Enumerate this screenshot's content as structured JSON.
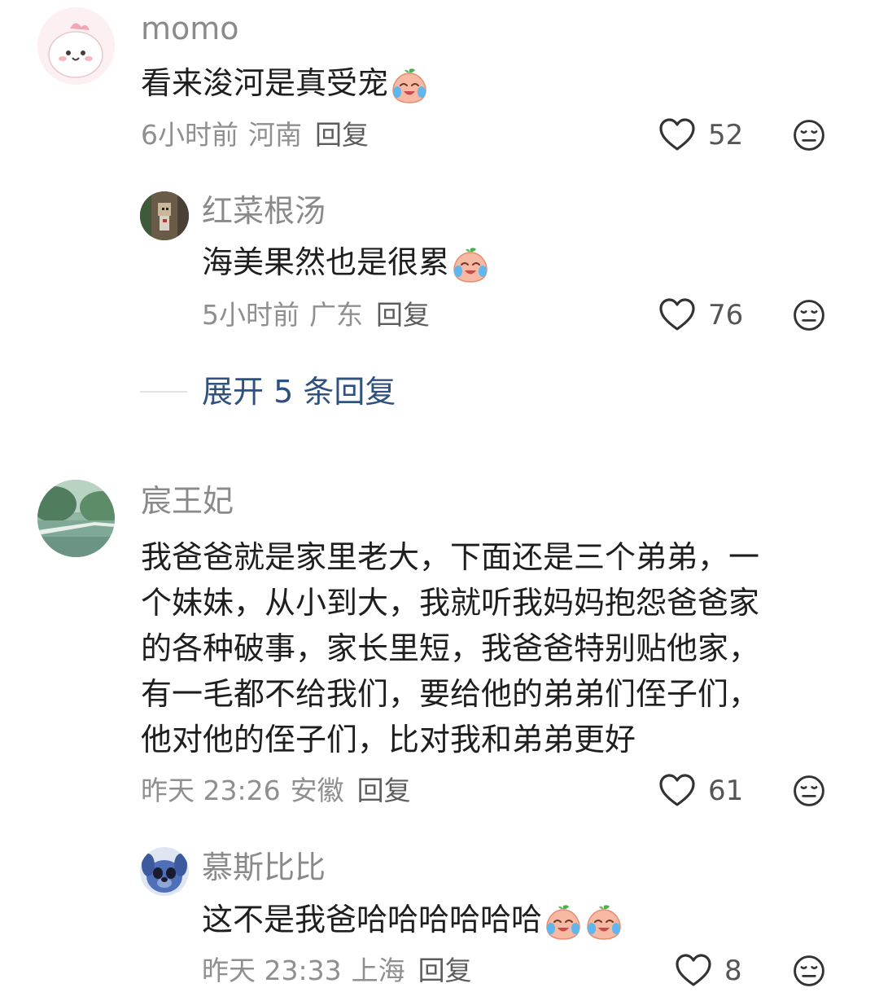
{
  "comments": [
    {
      "user": "momo",
      "text": "看来浚河是真受宠",
      "time": "6小时前",
      "location": "河南",
      "reply_label": "回复",
      "likes": "52",
      "replies": [
        {
          "user": "红菜根汤",
          "text": "海美果然也是很累",
          "time": "5小时前",
          "location": "广东",
          "reply_label": "回复",
          "likes": "76"
        }
      ],
      "expand_label": "展开 5 条回复"
    },
    {
      "user": "宸王妃",
      "text_lines": [
        "我爸爸就是家里老大，下面还是三个弟弟，一",
        "个妹妹，从小到大，我就听我妈妈抱怨爸爸家",
        "的各种破事，家长里短，我爸爸特别贴他家，",
        "有一毛都不给我们，要给他的弟弟们侄子们，",
        "他对他的侄子们，比对我和弟弟更好"
      ],
      "time": "昨天 23:26",
      "location": "安徽",
      "reply_label": "回复",
      "likes": "61",
      "replies": [
        {
          "user": "慕斯比比",
          "text": "这不是我爸哈哈哈哈哈哈",
          "time": "昨天 23:33",
          "location": "上海",
          "reply_label": "回复",
          "likes": "8"
        }
      ]
    }
  ],
  "icons": {
    "like": "heart-outline-icon",
    "dislike": "meh-face-icon",
    "emoji": "crying-laughing-peach-emoji"
  },
  "colors": {
    "expand_text": "#2f5180",
    "username": "#8a8a8a",
    "body_text": "#1e1e1e"
  }
}
